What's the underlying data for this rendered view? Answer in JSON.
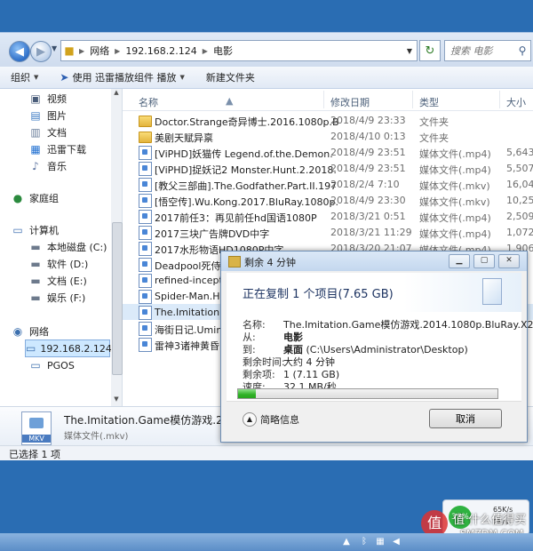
{
  "address": {
    "crumbs": [
      "网络",
      "192.168.2.124",
      "电影"
    ]
  },
  "search": {
    "placeholder": "搜索 电影"
  },
  "toolbar": {
    "organize": "组织",
    "play_with": "使用 迅雷播放组件 播放",
    "new_folder": "新建文件夹"
  },
  "nav": {
    "items": [
      "视频",
      "图片",
      "文档",
      "迅雷下载",
      "音乐",
      "家庭组",
      "计算机",
      "本地磁盘 (C:)",
      "软件 (D:)",
      "文档 (E:)",
      "娱乐 (F:)",
      "网络",
      "192.168.2.124",
      "PGOS"
    ]
  },
  "columns": {
    "name": "名称",
    "date": "修改日期",
    "type": "类型",
    "size": "大小"
  },
  "files": [
    {
      "name": "Doctor.Strange奇异博士.2016.1080p.B",
      "date": "2018/4/9 23:33",
      "type": "文件夹",
      "size": "",
      "kind": "folder"
    },
    {
      "name": "美剧天赋异禀",
      "date": "2018/4/10 0:13",
      "type": "文件夹",
      "size": "",
      "kind": "folder"
    },
    {
      "name": "[ViPHD]妖猫传 Legend.of.the.Demon.",
      "date": "2018/4/9 23:51",
      "type": "媒体文件(.mp4)",
      "size": "5,643,",
      "kind": "media"
    },
    {
      "name": "[ViPHD]捉妖记2 Monster.Hunt.2.2018.",
      "date": "2018/4/9 23:51",
      "type": "媒体文件(.mp4)",
      "size": "5,507,",
      "kind": "media"
    },
    {
      "name": "[教父三部曲].The.Godfather.Part.II.197",
      "date": "2018/2/4 7:10",
      "type": "媒体文件(.mkv)",
      "size": "16,043",
      "kind": "media"
    },
    {
      "name": "[悟空传].Wu.Kong.2017.BluRay.1080p.",
      "date": "2018/4/9 23:30",
      "type": "媒体文件(.mkv)",
      "size": "10,252",
      "kind": "media"
    },
    {
      "name": "2017前任3：再见前任hd国语1080P",
      "date": "2018/3/21 0:51",
      "type": "媒体文件(.mp4)",
      "size": "2,509,",
      "kind": "media"
    },
    {
      "name": "2017三块广告牌DVD中字",
      "date": "2018/3/21 11:29",
      "type": "媒体文件(.mp4)",
      "size": "1,072,",
      "kind": "media"
    },
    {
      "name": "2017水形物语HD1080P中字",
      "date": "2018/3/20 21:07",
      "type": "媒体文件(.mp4)",
      "size": "1,906,",
      "kind": "media"
    },
    {
      "name": "Deadpool死侍.2",
      "date": "",
      "type": "",
      "size": "",
      "kind": "media"
    },
    {
      "name": "refined-inceptio",
      "date": "",
      "type": "",
      "size": "",
      "kind": "media"
    },
    {
      "name": "Spider-Man.Ho",
      "date": "",
      "type": "",
      "size": "",
      "kind": "media"
    },
    {
      "name": "The.Imitation.Ga",
      "date": "",
      "type": "",
      "size": "",
      "kind": "media"
    },
    {
      "name": "海街日记.Umima",
      "date": "",
      "type": "",
      "size": "",
      "kind": "media"
    },
    {
      "name": "雷神3诸神黄昏",
      "date": "",
      "type": "",
      "size": "",
      "kind": "media"
    }
  ],
  "details": {
    "icon_label": "MKV",
    "name": "The.Imitation.Game模仿游戏.2014.1",
    "type": "媒体文件(.mkv)"
  },
  "status": {
    "text": "已选择 1 项"
  },
  "dialog": {
    "title": "剩余 4 分钟",
    "heading": "正在复制 1 个项目(7.65 GB)",
    "name_label": "名称:",
    "name_value": "The.Imitation.Game模仿游戏.2014.1080p.BluRay.X2...",
    "from_label": "从:",
    "from_value": "电影",
    "to_label": "到:",
    "to_value_bold": "桌面",
    "to_value": "(C:\\Users\\Administrator\\Desktop)",
    "remaining_time_label": "剩余时间:",
    "remaining_time_value": "大约 4 分钟",
    "remaining_items_label": "剩余项:",
    "remaining_items_value": "1 (7.11 GB)",
    "speed_label": "速度:",
    "speed_value": "32.1 MB/秒",
    "progress_fraction": 0.07,
    "less_info": "简略信息",
    "cancel": "取消"
  },
  "widget": {
    "percent": "33%",
    "speed_up": "65K/s",
    "speed_down": "0K/s"
  },
  "watermark": {
    "line1": "值 什么值得买",
    "line2": "SMZDM.COM"
  },
  "colors": {
    "accent": "#2a6db3",
    "progress": "#2fb226",
    "selection": "#dbeaf9"
  }
}
